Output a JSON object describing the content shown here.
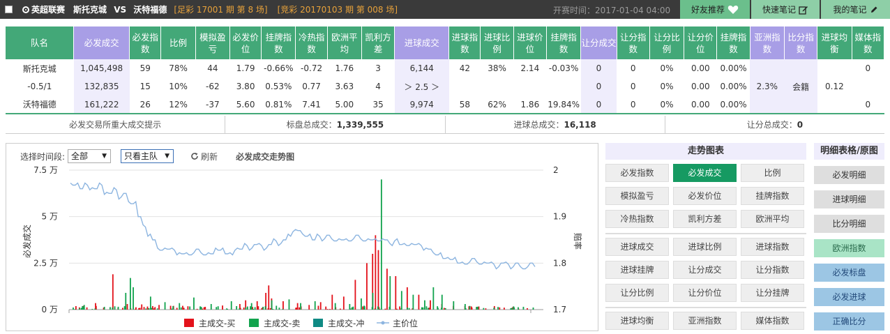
{
  "topbar": {
    "league": "英超联赛",
    "home": "斯托克城",
    "vs": "VS",
    "away": "沃特福德",
    "issue_zucai": "[足彩 17001 期 第 8 场]",
    "issue_jingcai": "[竞彩 20170103 期 第 008 场]",
    "start_time": "开赛时间：2017-01-04 04:00",
    "btn_friend": "好友推荐",
    "btn_quicknote": "快速笔记",
    "btn_mynote": "我的笔记"
  },
  "table": {
    "headers": [
      "队名",
      "必发成交",
      "必发指数",
      "比例",
      "模拟盈亏",
      "必发价位",
      "挂牌指数",
      "冷热指数",
      "欧洲平均",
      "凯利方差",
      "进球成交",
      "进球指数",
      "进球比例",
      "进球价位",
      "挂牌指数",
      "让分成交",
      "让分指数",
      "让分比例",
      "让分价位",
      "挂牌指数",
      "亚洲指数",
      "比分指数",
      "进球均衡",
      "媒体指数"
    ],
    "rows": [
      [
        "斯托克城",
        "1,045,498",
        "59",
        "78%",
        "44",
        "1.79",
        "-0.66%",
        "-0.72",
        "1.76",
        "3",
        "6,144",
        "42",
        "38%",
        "2.14",
        "-0.03%",
        "0",
        "0",
        "0%",
        "0.00",
        "0.00%",
        "",
        "",
        "",
        "0"
      ],
      [
        "-0.5/1",
        "132,835",
        "15",
        "10%",
        "-62",
        "3.80",
        "0.53%",
        "0.77",
        "3.63",
        "4",
        "＞ 2.5 ＞",
        "",
        "",
        "",
        "",
        "0",
        "0",
        "0%",
        "0.00",
        "0.00%",
        "2.3%",
        "会籍",
        "0.12",
        ""
      ],
      [
        "沃特福德",
        "161,222",
        "26",
        "12%",
        "-37",
        "5.60",
        "0.81%",
        "7.41",
        "5.00",
        "35",
        "9,974",
        "58",
        "62%",
        "1.86",
        "19.84%",
        "0",
        "0",
        "0%",
        "0.00",
        "0.00%",
        "",
        "",
        "",
        "0"
      ]
    ]
  },
  "summary": {
    "tip": "必发交易所重大成交提示",
    "total_label": "标盘总成交：",
    "total_value": "1,339,555",
    "goal_label": "进球总成交：",
    "goal_value": "16,118",
    "hcp_label": "让分总成交：",
    "hcp_value": "0"
  },
  "chart_panel": {
    "period_label": "选择时间段:",
    "period_value": "全部",
    "team_value": "只看主队",
    "refresh": "刷新",
    "title": "必发成交走势图"
  },
  "chart_data": {
    "type": "bar",
    "title": "必发成交走势图",
    "ylabel": "必发成交",
    "y2label": "赔率",
    "ylim": [
      0,
      75000
    ],
    "y2lim": [
      1.7,
      2.0
    ],
    "yticks": [
      "0 万",
      "2.5 万",
      "5 万",
      "7.5 万"
    ],
    "y2ticks": [
      "1.7",
      "1.8",
      "1.9",
      "2"
    ],
    "legend": [
      "主成交-买",
      "主成交-卖",
      "主成交-冲",
      "主价位"
    ],
    "colors": {
      "buy": "#e3121b",
      "sell": "#12a34e",
      "chong": "#0f8a84",
      "price": "#8db5e0"
    },
    "n": 300,
    "buy_peaks": [
      [
        25,
        1200
      ],
      [
        40,
        3500
      ],
      [
        70,
        19000
      ],
      [
        95,
        3000
      ],
      [
        120,
        2800
      ],
      [
        150,
        2500
      ],
      [
        175,
        2000
      ],
      [
        200,
        1800
      ],
      [
        230,
        1500
      ],
      [
        260,
        2200
      ],
      [
        290,
        3000
      ],
      [
        300,
        5000
      ],
      [
        320,
        4500
      ],
      [
        335,
        9000
      ],
      [
        340,
        13000
      ],
      [
        345,
        6000
      ],
      [
        365,
        4500
      ],
      [
        390,
        3500
      ],
      [
        410,
        2500
      ],
      [
        430,
        4000
      ],
      [
        450,
        8000
      ],
      [
        470,
        7000
      ],
      [
        490,
        16000
      ],
      [
        510,
        25000
      ],
      [
        520,
        30000
      ],
      [
        525,
        40000
      ],
      [
        530,
        32000
      ],
      [
        545,
        22000
      ],
      [
        560,
        18000
      ],
      [
        580,
        12000
      ],
      [
        600,
        8000
      ],
      [
        620,
        5000
      ],
      [
        640,
        3000
      ],
      [
        660,
        2000
      ],
      [
        680,
        2000
      ],
      [
        700,
        1500
      ],
      [
        740,
        1200
      ],
      [
        760,
        800
      ]
    ],
    "sell_peaks": [
      [
        20,
        2500
      ],
      [
        55,
        1500
      ],
      [
        92,
        9000
      ],
      [
        100,
        17000
      ],
      [
        105,
        12000
      ],
      [
        135,
        7000
      ],
      [
        160,
        4000
      ],
      [
        185,
        3500
      ],
      [
        210,
        6500
      ],
      [
        240,
        3000
      ],
      [
        275,
        4500
      ],
      [
        310,
        3500
      ],
      [
        345,
        5000
      ],
      [
        375,
        5500
      ],
      [
        395,
        3500
      ],
      [
        420,
        4500
      ],
      [
        455,
        3500
      ],
      [
        480,
        3000
      ],
      [
        500,
        6000
      ],
      [
        520,
        9000
      ],
      [
        535,
        70000
      ],
      [
        550,
        18000
      ],
      [
        570,
        10000
      ],
      [
        590,
        8000
      ],
      [
        610,
        5000
      ],
      [
        625,
        12000
      ],
      [
        640,
        8000
      ],
      [
        660,
        4500
      ],
      [
        680,
        3000
      ],
      [
        700,
        1500
      ],
      [
        730,
        1000
      ],
      [
        765,
        1200
      ]
    ],
    "price": [
      1.97,
      1.97,
      1.96,
      1.97,
      1.96,
      1.96,
      1.97,
      1.95,
      1.95,
      1.96,
      1.94,
      1.95,
      1.93,
      1.93,
      1.9,
      1.88,
      1.86,
      1.85,
      1.83,
      1.83,
      1.83,
      1.83,
      1.82,
      1.82,
      1.82,
      1.82,
      1.83,
      1.82,
      1.82,
      1.82,
      1.83,
      1.83,
      1.82,
      1.82,
      1.83,
      1.83,
      1.84,
      1.83,
      1.84,
      1.84,
      1.83,
      1.84,
      1.85,
      1.84,
      1.85,
      1.86,
      1.87,
      1.87,
      1.86,
      1.86,
      1.85,
      1.86,
      1.85,
      1.86,
      1.85,
      1.85,
      1.85,
      1.85,
      1.85,
      1.86,
      1.85,
      1.85,
      1.85,
      1.85,
      1.85,
      1.85,
      1.84,
      1.85,
      1.84,
      1.84,
      1.84,
      1.84,
      1.84,
      1.83,
      1.83,
      1.82,
      1.82,
      1.81,
      1.81,
      1.81,
      1.8,
      1.8,
      1.8,
      1.81,
      1.8,
      1.8,
      1.8,
      1.8,
      1.79,
      1.8,
      1.8,
      1.79,
      1.8,
      1.79,
      1.79,
      1.8,
      1.79
    ]
  },
  "trend": {
    "header": "走势图表",
    "buttons": [
      "必发指数",
      "必发成交",
      "比例",
      "模拟盈亏",
      "必发价位",
      "挂牌指数",
      "冷热指数",
      "凯利方差",
      "欧洲平均",
      "进球成交",
      "进球比例",
      "进球指数",
      "进球挂牌",
      "让分成交",
      "让分指数",
      "让分比例",
      "让分价位",
      "让分挂牌",
      "进球均衡",
      "亚洲指数",
      "媒体指数"
    ],
    "active": "必发成交"
  },
  "detail": {
    "header": "明细表格/原图",
    "buttons": [
      "必发明细",
      "进球明细",
      "比分明细",
      "欧洲指数",
      "必发标盘",
      "必发进球",
      "正确比分"
    ]
  }
}
